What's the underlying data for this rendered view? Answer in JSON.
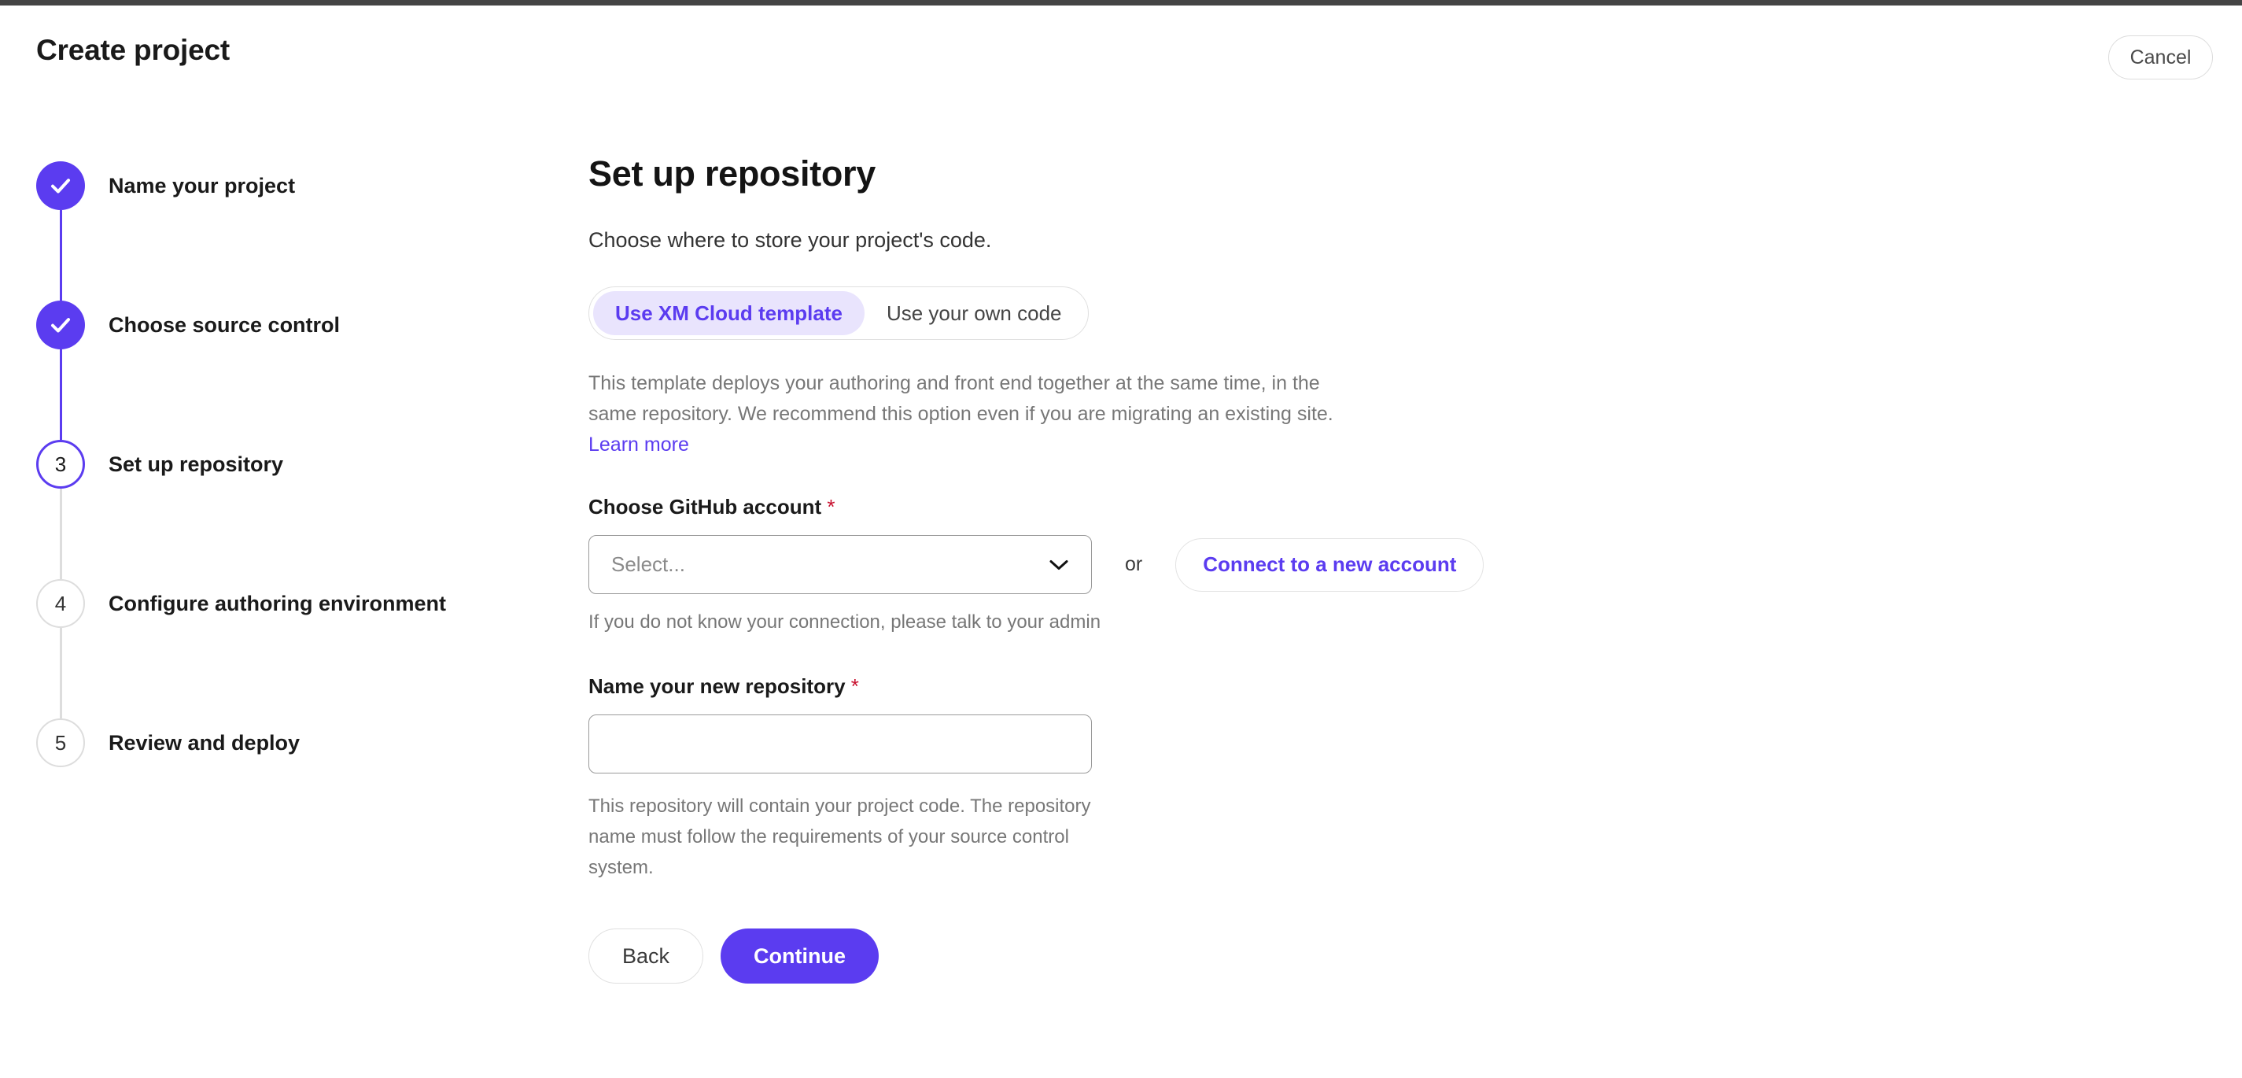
{
  "colors": {
    "accent": "#5B3CF0",
    "accent_soft": "#e9e4fd",
    "required": "#c8102e",
    "muted_text": "#777777",
    "top_bar": "#444444"
  },
  "header": {
    "title": "Create project",
    "cancel_label": "Cancel"
  },
  "stepper": {
    "steps": [
      {
        "number": "1",
        "label": "Name your project",
        "state": "done"
      },
      {
        "number": "2",
        "label": "Choose source control",
        "state": "done"
      },
      {
        "number": "3",
        "label": "Set up repository",
        "state": "current"
      },
      {
        "number": "4",
        "label": "Configure authoring environment",
        "state": "upcoming"
      },
      {
        "number": "5",
        "label": "Review and deploy",
        "state": "upcoming"
      }
    ]
  },
  "main": {
    "title": "Set up repository",
    "subtitle": "Choose where to store your project's code.",
    "toggle": {
      "options": [
        {
          "label": "Use XM Cloud template",
          "selected": true
        },
        {
          "label": "Use your own code",
          "selected": false
        }
      ]
    },
    "template_description": "This template deploys your authoring and front end together at the same time, in the same repository. We recommend this option even if you are migrating an existing site.",
    "learn_more_label": "Learn more",
    "github_account": {
      "label": "Choose GitHub account",
      "required_marker": "*",
      "select_placeholder": "Select...",
      "or_label": "or",
      "connect_button_label": "Connect to a new account",
      "helper_text": "If you do not know your connection, please talk to your admin"
    },
    "repository_name": {
      "label": "Name your new repository",
      "required_marker": "*",
      "value": "",
      "placeholder": "",
      "helper_text": "This repository will contain your project code. The repository name must follow the requirements of your source control system."
    },
    "actions": {
      "back_label": "Back",
      "continue_label": "Continue"
    }
  }
}
